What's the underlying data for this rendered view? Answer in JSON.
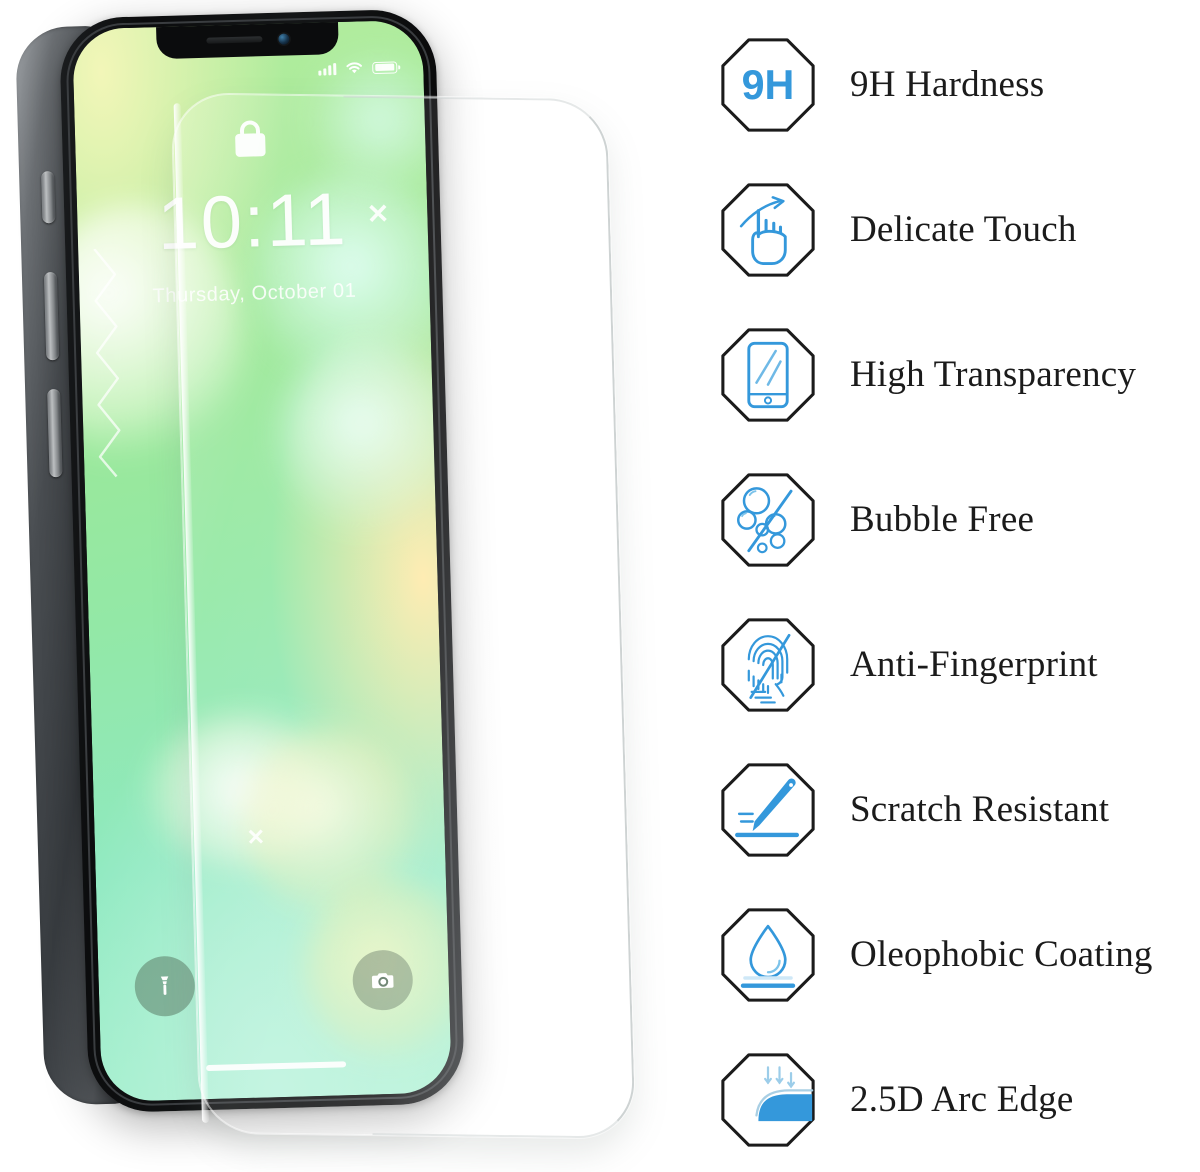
{
  "product": {
    "type": "tempered-glass-screen-protector",
    "phone": {
      "lock_screen": {
        "time": "10:11",
        "date": "Thursday, October 01",
        "lock_icon": "lock-icon",
        "status_icons": [
          "cellular-signal-icon",
          "wifi-icon",
          "battery-icon"
        ],
        "shortcuts": [
          {
            "name": "flashlight-shortcut",
            "icon": "flashlight-icon"
          },
          {
            "name": "camera-shortcut",
            "icon": "camera-icon"
          }
        ],
        "home_indicator": true,
        "decor_marks": [
          "x",
          "x"
        ]
      },
      "hardware_buttons": [
        "mute-switch",
        "volume-up-button",
        "volume-down-button"
      ],
      "notch_parts": [
        "earpiece-speaker",
        "front-camera"
      ]
    },
    "colors": {
      "accent_blue": "#3498db",
      "icon_outline": "#1b1b1b",
      "text": "#1b1b1b",
      "wallpaper_green": "#9ee894",
      "wallpaper_mint": "#8fe9c0",
      "phone_body": "#0b0c0d",
      "background": "#ffffff"
    }
  },
  "features": [
    {
      "id": "hardness",
      "label": "9H Hardness",
      "icon": "9h-hardness-icon",
      "badge_text": "9H"
    },
    {
      "id": "touch",
      "label": "Delicate Touch",
      "icon": "delicate-touch-icon",
      "badge_text": ""
    },
    {
      "id": "transparency",
      "label": "High Transparency",
      "icon": "high-transparency-icon",
      "badge_text": ""
    },
    {
      "id": "bubble",
      "label": "Bubble Free",
      "icon": "bubble-free-icon",
      "badge_text": ""
    },
    {
      "id": "fingerprint",
      "label": "Anti-Fingerprint",
      "icon": "anti-fingerprint-icon",
      "badge_text": ""
    },
    {
      "id": "scratch",
      "label": "Scratch Resistant",
      "icon": "scratch-resistant-icon",
      "badge_text": ""
    },
    {
      "id": "oleophobic",
      "label": "Oleophobic Coating",
      "icon": "oleophobic-coating-icon",
      "badge_text": ""
    },
    {
      "id": "arc",
      "label": "2.5D Arc Edge",
      "icon": "arc-edge-icon",
      "badge_text": ""
    }
  ]
}
